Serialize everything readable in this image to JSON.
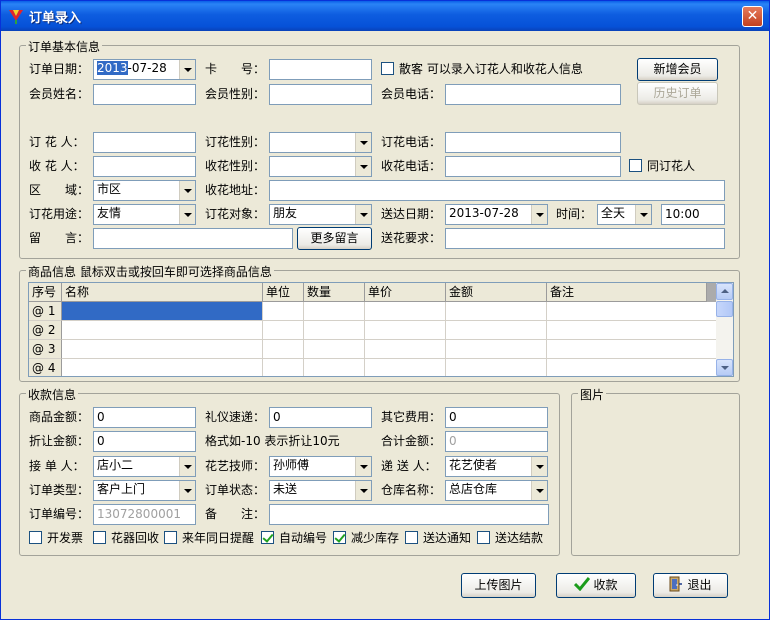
{
  "window": {
    "title": "订单录入"
  },
  "basic": {
    "group_title": "订单基本信息",
    "order_date_label": "订单日期：",
    "order_date_sel": "2013",
    "order_date_rest": "-07-28",
    "card_no_label": "卡　　号：",
    "card_no_value": "",
    "walkin_label": "散客 可以录入订花人和收花人信息",
    "walkin_checked": false,
    "new_member_btn": "新增会员",
    "history_btn": "历史订单",
    "member_name_label": "会员姓名：",
    "member_name_value": "",
    "member_gender_label": "会员性别：",
    "member_gender_value": "",
    "member_phone_label": "会员电话：",
    "member_phone_value": "",
    "orderer_label": "订 花 人：",
    "orderer_value": "",
    "orderer_gender_label": "订花性别：",
    "orderer_gender_value": "",
    "orderer_phone_label": "订花电话：",
    "orderer_phone_value": "",
    "receiver_label": "收 花 人：",
    "receiver_value": "",
    "receiver_gender_label": "收花性别：",
    "receiver_gender_value": "",
    "receiver_phone_label": "收花电话：",
    "receiver_phone_value": "",
    "same_as_orderer_label": "同订花人",
    "same_as_orderer_checked": false,
    "area_label": "区　　域：",
    "area_value": "市区",
    "address_label": "收花地址：",
    "address_value": "",
    "purpose_label": "订花用途：",
    "purpose_value": "友情",
    "target_label": "订花对象：",
    "target_value": "朋友",
    "delivery_date_label": "送达日期：",
    "delivery_date_value": "2013-07-28",
    "time_label": "时间：",
    "time_value": "全天",
    "time_input": "10:00",
    "message_label": "留　　言：",
    "message_value": "",
    "more_message_btn": "更多留言",
    "requirement_label": "送花要求：",
    "requirement_value": ""
  },
  "goods": {
    "group_title": "商品信息 鼠标双击或按回车即可选择商品信息",
    "columns": [
      "序号",
      "名称",
      "单位",
      "数量",
      "单价",
      "金额",
      "备注"
    ],
    "rows": [
      "@ 1",
      "@ 2",
      "@ 3",
      "@ 4"
    ]
  },
  "payment": {
    "group_title": "收款信息",
    "goods_amount_label": "商品金额：",
    "goods_amount_value": "0",
    "gift_delivery_label": "礼仪速递：",
    "gift_delivery_value": "0",
    "other_fee_label": "其它费用：",
    "other_fee_value": "0",
    "discount_label": "折让金额：",
    "discount_value": "0",
    "discount_hint": "格式如-10 表示折让10元",
    "total_label": "合计金额：",
    "total_value": "0",
    "receiver_label": "接 单 人：",
    "receiver_value": "店小二",
    "florist_label": "花艺技师：",
    "florist_value": "孙师傅",
    "courier_label": "递 送 人：",
    "courier_value": "花艺使者",
    "order_type_label": "订单类型：",
    "order_type_value": "客户上门",
    "order_status_label": "订单状态：",
    "order_status_value": "未送",
    "warehouse_label": "仓库名称：",
    "warehouse_value": "总店仓库",
    "order_no_label": "订单编号：",
    "order_no_value": "13072800001",
    "remark_label": "备　　注：",
    "remark_value": ""
  },
  "options": [
    {
      "label": "开发票",
      "checked": false
    },
    {
      "label": "花器回收",
      "checked": false
    },
    {
      "label": "来年同日提醒",
      "checked": false
    },
    {
      "label": "自动编号",
      "checked": true
    },
    {
      "label": "减少库存",
      "checked": true
    },
    {
      "label": "送达通知",
      "checked": false
    },
    {
      "label": "送达结款",
      "checked": false
    }
  ],
  "picture": {
    "group_title": "图片"
  },
  "actions": {
    "upload_btn": "上传图片",
    "collect_btn": "收款",
    "exit_btn": "退出"
  },
  "colors": {
    "title_bar": "#0a5fe8",
    "selection": "#316ac5",
    "face": "#ece9d8"
  }
}
